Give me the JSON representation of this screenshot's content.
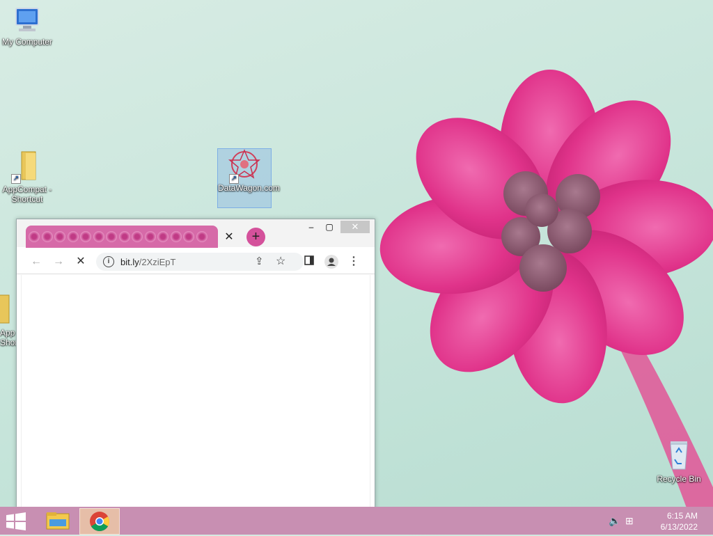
{
  "desktop": {
    "icons": [
      {
        "label": "My Computer"
      },
      {
        "label": "AppCompat - Shortcut"
      },
      {
        "label": "DataWagon.com"
      },
      {
        "label": "App Shortcut"
      },
      {
        "label": "Recycle Bin"
      }
    ]
  },
  "browser": {
    "tab_count": 14,
    "new_tab_symbol": "+",
    "tab_close_symbol": "✕",
    "address": {
      "host": "bit.ly",
      "path": "/2XziEpT"
    },
    "window_controls": {
      "minimize": "–",
      "maximize": "▢",
      "close": "✕"
    },
    "toolbar_icons": [
      "back-icon",
      "forward-icon",
      "stop-icon",
      "info-icon",
      "share-icon",
      "star-icon",
      "side-panel-icon",
      "profile-icon",
      "menu-icon"
    ]
  },
  "taskbar": {
    "clock_time": "6:15 AM",
    "clock_date": "6/13/2022",
    "apps": [
      "file-explorer-icon",
      "chrome-icon"
    ]
  },
  "colors": {
    "taskbar": "#c88fb2",
    "tab_strip": "#d66aa8",
    "new_tab": "#d4519b",
    "flower": "#e0338a"
  }
}
